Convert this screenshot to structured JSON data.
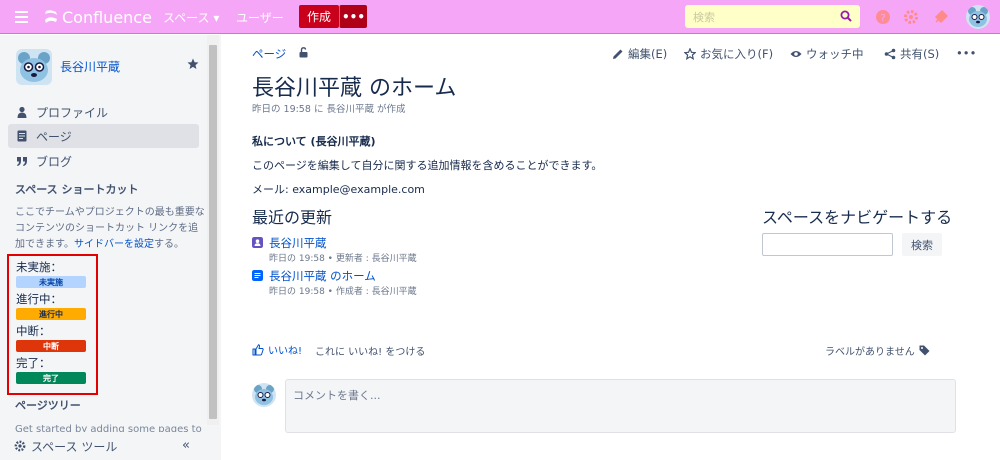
{
  "topbar": {
    "app_name": "Confluence",
    "nav_spaces": "スペース ▾",
    "nav_users": "ユーザー",
    "create_label": "作成",
    "more_label": "•••",
    "search_placeholder": "検索",
    "colors": {
      "bar": "#f6a6f6",
      "create": "#c9001b",
      "search_bg": "#ffffc8"
    },
    "icons": [
      "menu-icon",
      "confluence-logo-icon",
      "search-icon",
      "help-icon",
      "settings-icon",
      "notifications-icon",
      "user-avatar"
    ]
  },
  "sidebar": {
    "space_name": "長谷川平蔵",
    "items": [
      {
        "label": "プロファイル",
        "icon": "person-icon"
      },
      {
        "label": "ページ",
        "icon": "page-icon"
      },
      {
        "label": "ブログ",
        "icon": "quote-icon"
      }
    ],
    "shortcut_title": "スペース ショートカット",
    "shortcut_desc": "ここでチームやプロジェクトの最も重要なコンテンツのショートカット リンクを追加できます。",
    "shortcut_link": "サイドバーを設定",
    "shortcut_tail": "する。",
    "statuses": [
      {
        "label": "未実施：",
        "lozenge": "未実施",
        "bg": "#b3d4ff",
        "fg": "#0747a6"
      },
      {
        "label": "進行中：",
        "lozenge": "進行中",
        "bg": "#ffab00",
        "fg": "#172b4d"
      },
      {
        "label": "中断：",
        "lozenge": "中断",
        "bg": "#de350b",
        "fg": "#ffffff"
      },
      {
        "label": "完了：",
        "lozenge": "完了",
        "bg": "#00875a",
        "fg": "#ffffff"
      }
    ],
    "tree_title": "ページツリー",
    "tree_desc": "Get started by adding some pages to this",
    "footer_label": "スペース ツール",
    "collapse_label": "«"
  },
  "main": {
    "breadcrumb": "ページ",
    "actions": {
      "edit": "編集(E)",
      "favorite": "お気に入り(F)",
      "watch": "ウォッチ中",
      "share": "共有(S)",
      "more": "•••"
    },
    "title": "長谷川平蔵 のホーム",
    "byline_date": "昨日の 19:58",
    "byline_mid": "に",
    "byline_author": "長谷川平蔵",
    "byline_tail": "が作成",
    "about": "私について (長谷川平蔵)",
    "desc": "このページを編集して自分に関する追加情報を含めることができます。",
    "email": "メール: example@example.com",
    "recent_title": "最近の更新",
    "updates": [
      {
        "title": "長谷川平蔵",
        "meta": "昨日の 19:58 • 更新者 : 長谷川平蔵",
        "icon": "profile-page-icon",
        "color": "#6554c0"
      },
      {
        "title": "長谷川平蔵 のホーム",
        "meta": "昨日の 19:58 • 作成者 : 長谷川平蔵",
        "icon": "page-icon",
        "color": "#0065ff"
      }
    ],
    "navigate_title": "スペースをナビゲートする",
    "navigate_button": "検索",
    "like_label": "いいね!",
    "like_hint": "これに いいね! をつける",
    "no_labels": "ラベルがありません",
    "comment_placeholder": "コメントを書く..."
  }
}
